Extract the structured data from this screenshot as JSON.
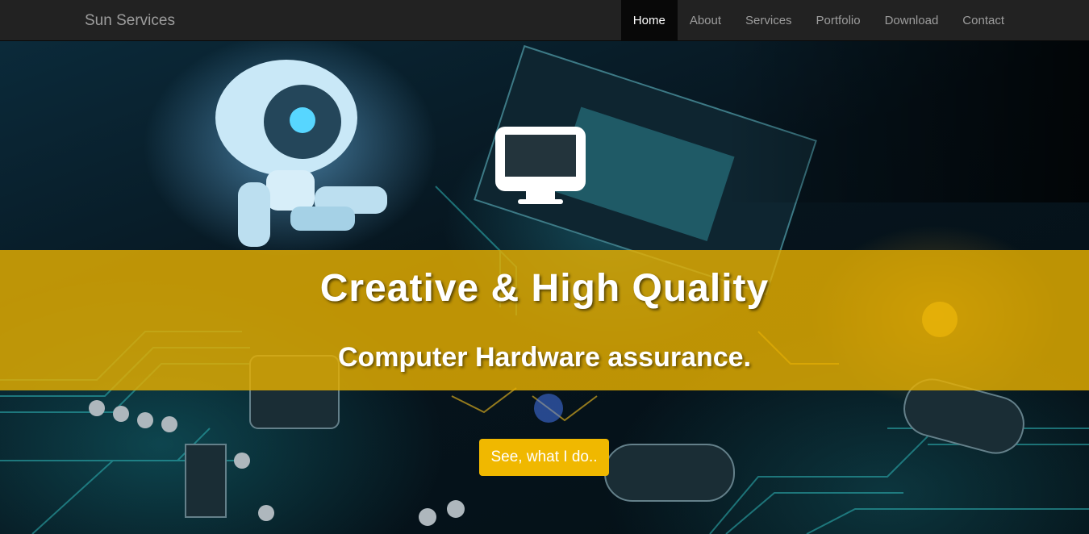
{
  "navbar": {
    "brand": "Sun Services",
    "items": [
      {
        "label": "Home",
        "active": true
      },
      {
        "label": "About",
        "active": false
      },
      {
        "label": "Services",
        "active": false
      },
      {
        "label": "Portfolio",
        "active": false
      },
      {
        "label": "Download",
        "active": false
      },
      {
        "label": "Contact",
        "active": false
      }
    ]
  },
  "hero": {
    "icon": "monitor-icon",
    "headline": "Creative & High Quality",
    "subline": "Computer Hardware assurance.",
    "cta_label": "See, what I do..",
    "band_color": "#e6b000",
    "cta_color": "#f0b800"
  },
  "colors": {
    "nav_bg": "#222222",
    "nav_active_bg": "#080808",
    "nav_text": "#9d9d9d"
  }
}
